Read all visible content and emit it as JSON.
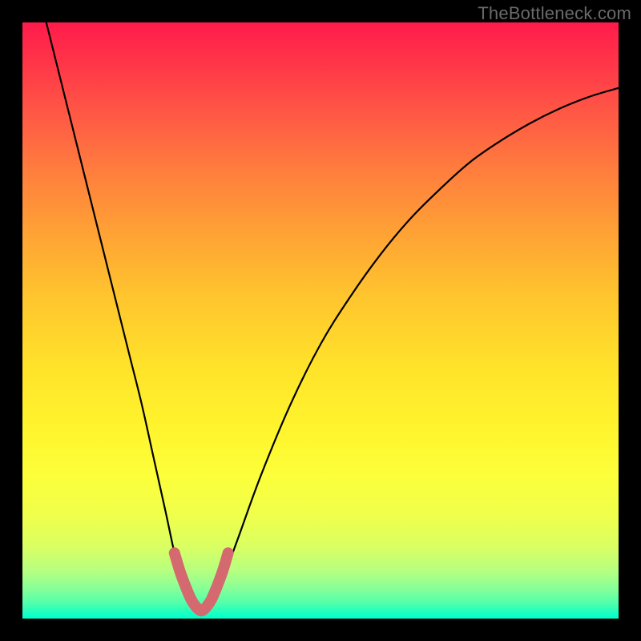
{
  "watermark": {
    "text": "TheBottleneck.com"
  },
  "chart_data": {
    "type": "line",
    "title": "",
    "xlabel": "",
    "ylabel": "",
    "xlim": [
      0,
      100
    ],
    "ylim": [
      0,
      100
    ],
    "series": [
      {
        "name": "bottleneck-curve",
        "x": [
          4,
          6,
          8,
          10,
          12,
          14,
          16,
          18,
          20,
          22,
          24,
          25.5,
          27,
          28.5,
          30,
          31.5,
          33,
          36,
          40,
          45,
          50,
          55,
          60,
          65,
          70,
          75,
          80,
          85,
          90,
          95,
          100
        ],
        "values": [
          100,
          92,
          84,
          76,
          68,
          60,
          52,
          44,
          36,
          27,
          18,
          11,
          5,
          2,
          1.3,
          2,
          5,
          13,
          24,
          36,
          46,
          54,
          61,
          67,
          72,
          76.5,
          80,
          83,
          85.5,
          87.5,
          89
        ]
      },
      {
        "name": "highlight-valley",
        "x": [
          25.5,
          26.4,
          27.4,
          28.3,
          29.1,
          29.6,
          30,
          30.4,
          30.9,
          31.7,
          32.6,
          33.6,
          34.5
        ],
        "values": [
          11,
          8,
          5.3,
          3.2,
          2,
          1.5,
          1.3,
          1.5,
          2,
          3.2,
          5.3,
          8,
          11
        ]
      }
    ],
    "colors": {
      "curve": "#000000",
      "highlight": "#d46a6f"
    }
  }
}
